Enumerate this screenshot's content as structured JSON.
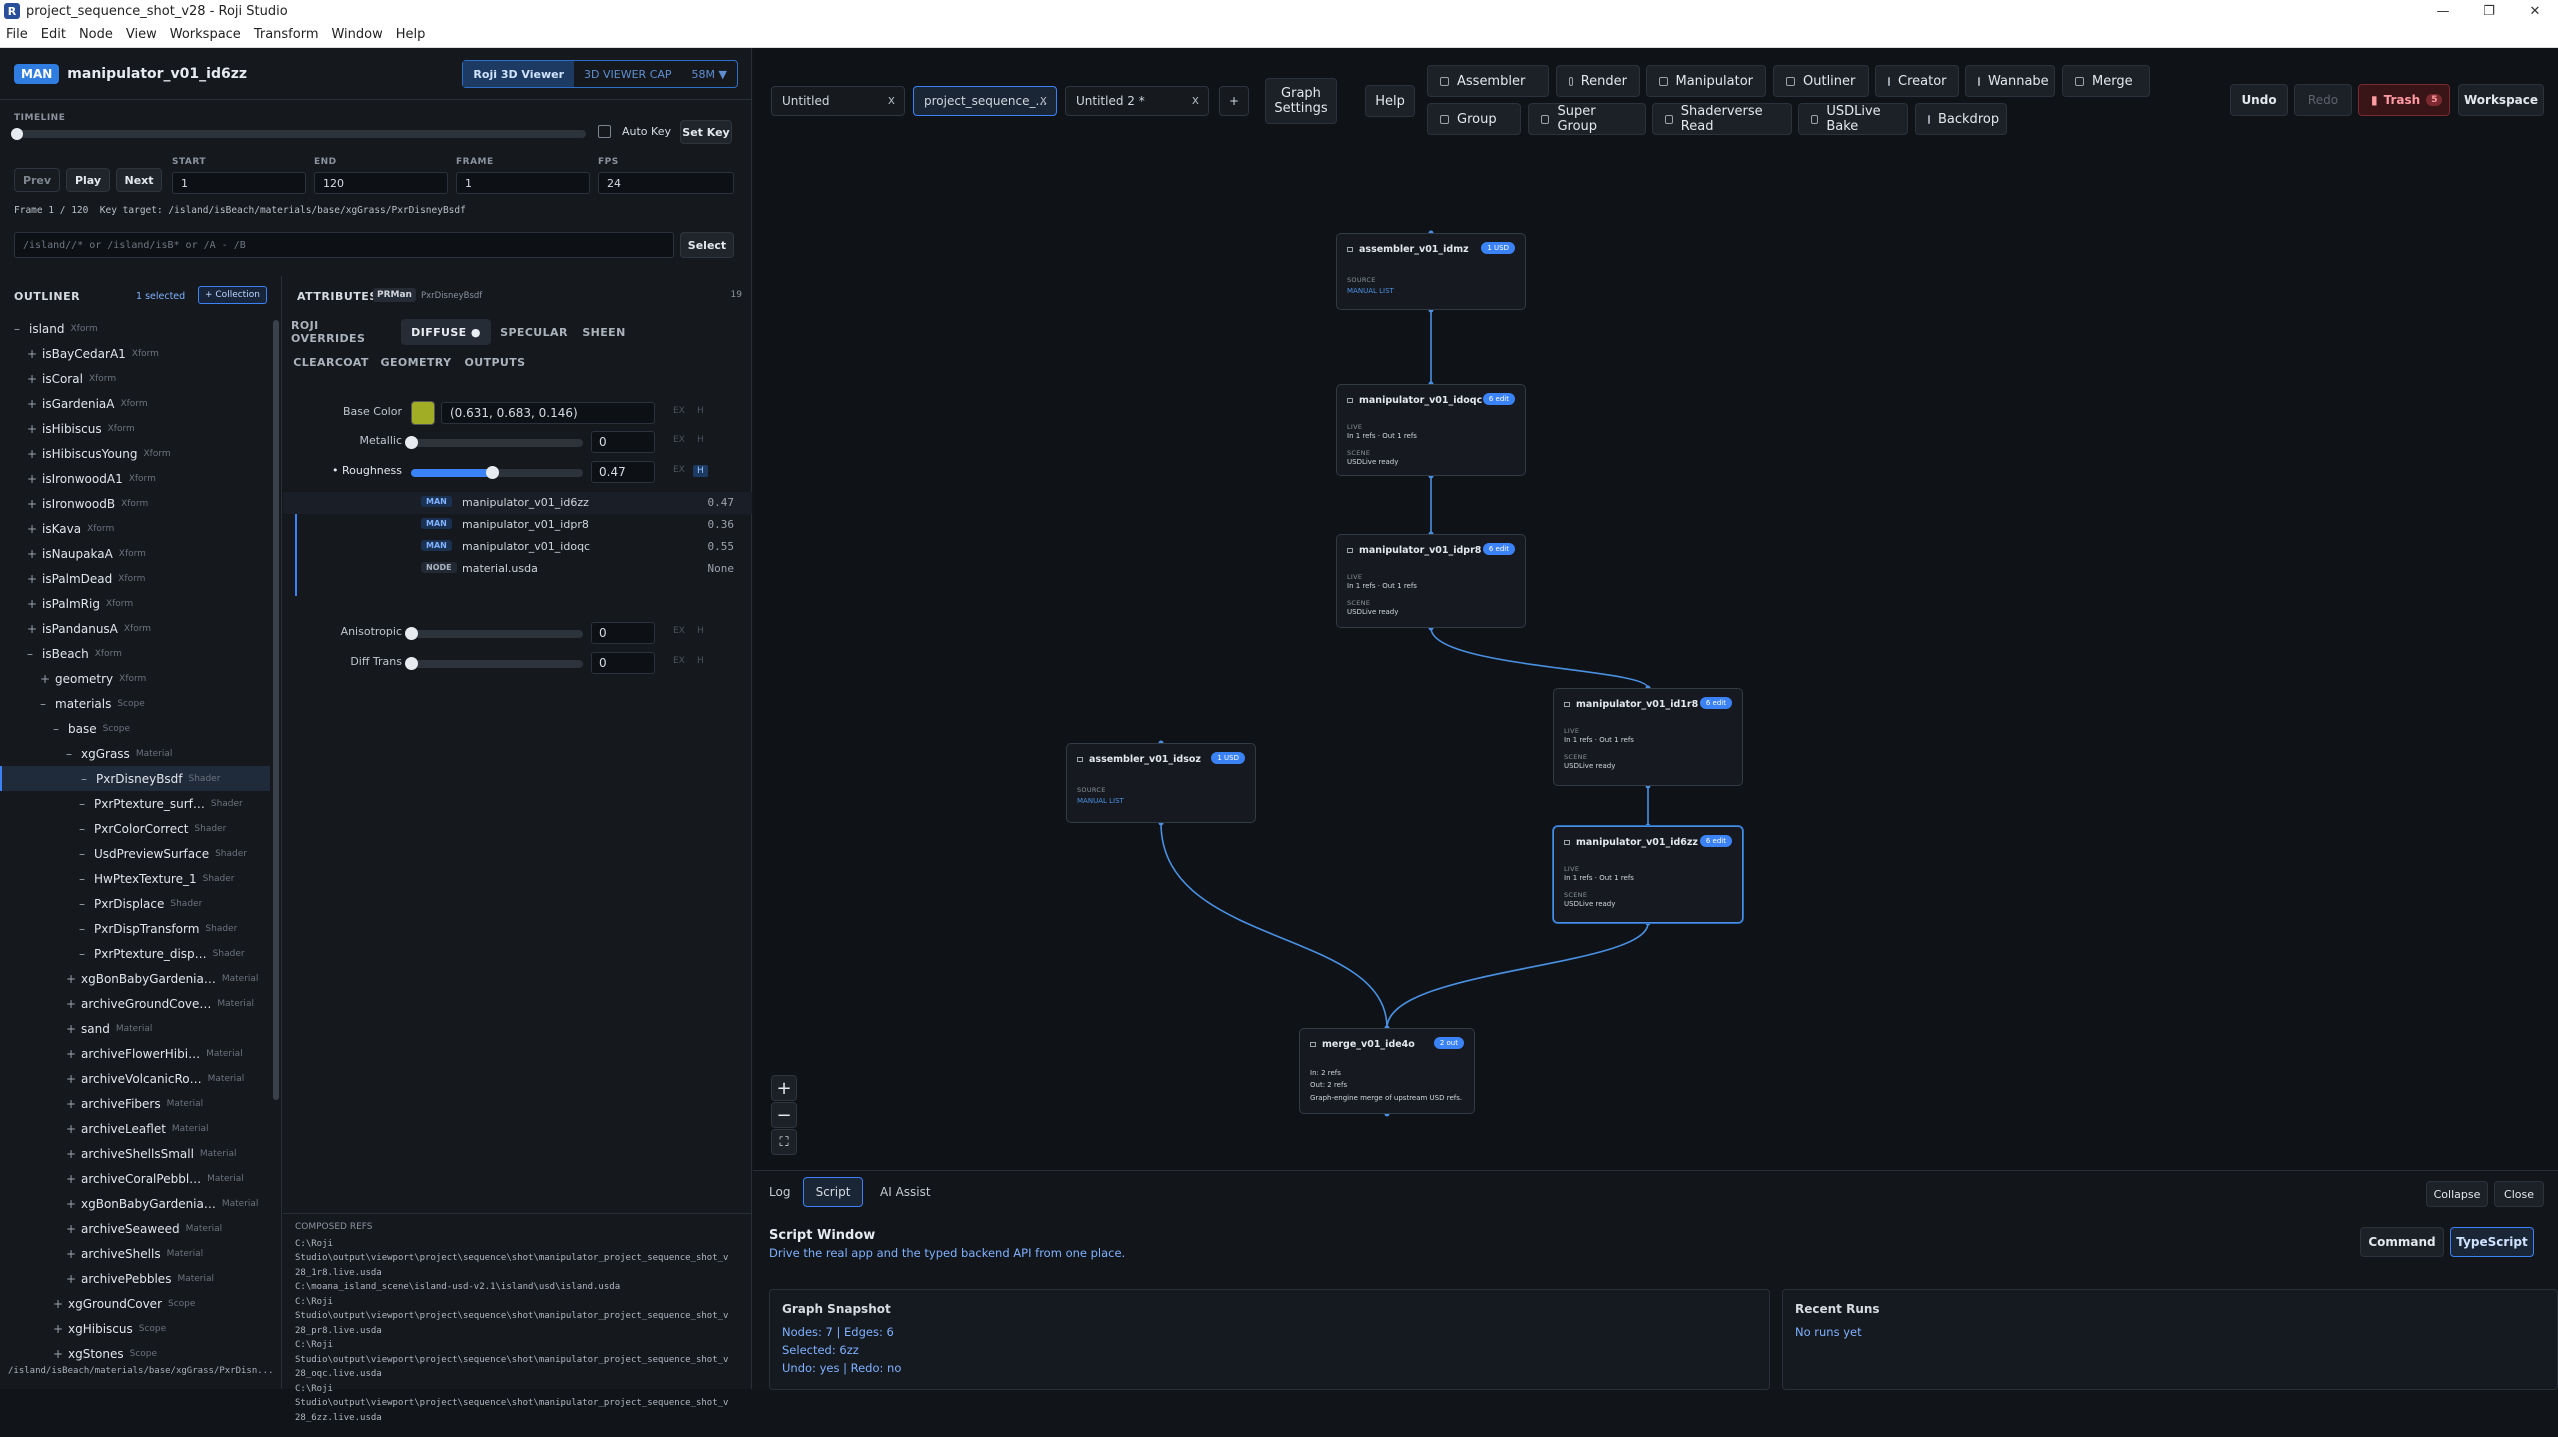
{
  "window": {
    "title": "project_sequence_shot_v28 - Roji Studio",
    "app_letter": "R"
  },
  "menu": [
    "File",
    "Edit",
    "Node",
    "View",
    "Workspace",
    "Transform",
    "Window",
    "Help"
  ],
  "header": {
    "badge": "MAN",
    "node_name": "manipulator_v01_id6zz",
    "viewer_on": "Roji 3D Viewer",
    "viewer_off": "3D VIEWER CAP",
    "viewer_size": "58M ▼"
  },
  "timeline": {
    "label": "TIMELINE",
    "auto_key": "Auto Key",
    "set_key": "Set Key",
    "progress": 0,
    "prev": "Prev",
    "play": "Play",
    "next": "Next",
    "start_label": "START",
    "start": "1",
    "end_label": "END",
    "end": "120",
    "frame_label": "FRAME",
    "frame": "1",
    "fps_label": "FPS",
    "fps": "24",
    "status": "Frame 1 / 120  Key target: /island/isBeach/materials/base/xgGrass/PxrDisneyBsdf",
    "select_placeholder": "/island//*  or  /island/isB*  or  /A - /B",
    "select_btn": "Select"
  },
  "outliner": {
    "title": "OUTLINER",
    "selected": "1 selected",
    "collection_btn": "+ Collection",
    "footer": "/island/isBeach/materials/base/xgGrass/PxrDisn...",
    "rows": [
      {
        "ind": 0,
        "ex": "–",
        "name": "island",
        "tag": "Xform"
      },
      {
        "ind": 1,
        "ex": "+",
        "name": "isBayCedarA1",
        "tag": "Xform"
      },
      {
        "ind": 1,
        "ex": "+",
        "name": "isCoral",
        "tag": "Xform"
      },
      {
        "ind": 1,
        "ex": "+",
        "name": "isGardeniaA",
        "tag": "Xform"
      },
      {
        "ind": 1,
        "ex": "+",
        "name": "isHibiscus",
        "tag": "Xform"
      },
      {
        "ind": 1,
        "ex": "+",
        "name": "isHibiscusYoung",
        "tag": "Xform"
      },
      {
        "ind": 1,
        "ex": "+",
        "name": "isIronwoodA1",
        "tag": "Xform"
      },
      {
        "ind": 1,
        "ex": "+",
        "name": "isIronwoodB",
        "tag": "Xform"
      },
      {
        "ind": 1,
        "ex": "+",
        "name": "isKava",
        "tag": "Xform"
      },
      {
        "ind": 1,
        "ex": "+",
        "name": "isNaupakaA",
        "tag": "Xform"
      },
      {
        "ind": 1,
        "ex": "+",
        "name": "isPalmDead",
        "tag": "Xform"
      },
      {
        "ind": 1,
        "ex": "+",
        "name": "isPalmRig",
        "tag": "Xform"
      },
      {
        "ind": 1,
        "ex": "+",
        "name": "isPandanusA",
        "tag": "Xform"
      },
      {
        "ind": 1,
        "ex": "–",
        "name": "isBeach",
        "tag": "Xform"
      },
      {
        "ind": 2,
        "ex": "+",
        "name": "geometry",
        "tag": "Xform"
      },
      {
        "ind": 2,
        "ex": "–",
        "name": "materials",
        "tag": "Scope"
      },
      {
        "ind": 3,
        "ex": "–",
        "name": "base",
        "tag": "Scope"
      },
      {
        "ind": 4,
        "ex": "–",
        "name": "xgGrass",
        "tag": "Material"
      },
      {
        "ind": 5,
        "ex": "–",
        "name": "PxrDisneyBsdf",
        "tag": "Shader",
        "sel": true
      },
      {
        "ind": 5,
        "ex": "–",
        "name": "PxrPtexture_surf…",
        "tag": "Shader"
      },
      {
        "ind": 5,
        "ex": "–",
        "name": "PxrColorCorrect",
        "tag": "Shader"
      },
      {
        "ind": 5,
        "ex": "–",
        "name": "UsdPreviewSurface",
        "tag": "Shader"
      },
      {
        "ind": 5,
        "ex": "–",
        "name": "HwPtexTexture_1",
        "tag": "Shader"
      },
      {
        "ind": 5,
        "ex": "–",
        "name": "PxrDisplace",
        "tag": "Shader"
      },
      {
        "ind": 5,
        "ex": "–",
        "name": "PxrDispTransform",
        "tag": "Shader"
      },
      {
        "ind": 5,
        "ex": "–",
        "name": "PxrPtexture_disp…",
        "tag": "Shader"
      },
      {
        "ind": 4,
        "ex": "+",
        "name": "xgBonBabyGardenia…",
        "tag": "Material"
      },
      {
        "ind": 4,
        "ex": "+",
        "name": "archiveGroundCove…",
        "tag": "Material"
      },
      {
        "ind": 4,
        "ex": "+",
        "name": "sand",
        "tag": "Material"
      },
      {
        "ind": 4,
        "ex": "+",
        "name": "archiveFlowerHibi…",
        "tag": "Material"
      },
      {
        "ind": 4,
        "ex": "+",
        "name": "archiveVolcanicRo…",
        "tag": "Material"
      },
      {
        "ind": 4,
        "ex": "+",
        "name": "archiveFibers",
        "tag": "Material"
      },
      {
        "ind": 4,
        "ex": "+",
        "name": "archiveLeaflet",
        "tag": "Material"
      },
      {
        "ind": 4,
        "ex": "+",
        "name": "archiveShellsSmall",
        "tag": "Material"
      },
      {
        "ind": 4,
        "ex": "+",
        "name": "archiveCoralPebbl…",
        "tag": "Material"
      },
      {
        "ind": 4,
        "ex": "+",
        "name": "xgBonBabyGardenia…",
        "tag": "Material"
      },
      {
        "ind": 4,
        "ex": "+",
        "name": "archiveSeaweed",
        "tag": "Material"
      },
      {
        "ind": 4,
        "ex": "+",
        "name": "archiveShells",
        "tag": "Material"
      },
      {
        "ind": 4,
        "ex": "+",
        "name": "archivePebbles",
        "tag": "Material"
      },
      {
        "ind": 3,
        "ex": "+",
        "name": "xgGroundCover",
        "tag": "Scope"
      },
      {
        "ind": 3,
        "ex": "+",
        "name": "xgHibiscus",
        "tag": "Scope"
      },
      {
        "ind": 3,
        "ex": "+",
        "name": "xgStones",
        "tag": "Scope"
      }
    ]
  },
  "attributes": {
    "title": "ATTRIBUTES",
    "renderer": "PRMan",
    "shader": "PxrDisneyBsdf",
    "count": "19",
    "tabs": [
      "ROJI OVERRIDES",
      "DIFFUSE ●",
      "SPECULAR",
      "SHEEN",
      "CLEARCOAT",
      "GEOMETRY",
      "OUTPUTS"
    ],
    "base_color_label": "Base Color",
    "base_color_value": "(0.631, 0.683, 0.146)",
    "base_color_hex": "#a1ae25",
    "metallic_label": "Metallic",
    "metallic_value": "0",
    "metallic_level": 0,
    "roughness_label": "• Roughness",
    "roughness_value": "0.47",
    "roughness_level": 0.47,
    "overrides": [
      {
        "type": "MAN",
        "name": "manipulator_v01_id6zz",
        "value": "0.47"
      },
      {
        "type": "MAN",
        "name": "manipulator_v01_idpr8",
        "value": "0.36"
      },
      {
        "type": "MAN",
        "name": "manipulator_v01_idoqc",
        "value": "0.55"
      },
      {
        "type": "NODE",
        "name": "material.usda",
        "value": "None"
      }
    ],
    "anisotropic_label": "Anisotropic",
    "anisotropic_value": "0",
    "anisotropic_level": 0,
    "difftrans_label": "Diff Trans",
    "difftrans_value": "0",
    "difftrans_level": 0,
    "ex": "EX",
    "h": "H"
  },
  "composed": {
    "title": "COMPOSED REFS",
    "lines": [
      "C:\\Roji",
      "Studio\\output\\viewport\\project\\sequence\\shot\\manipulator_project_sequence_shot_v",
      "28_1r8.live.usda",
      "C:\\moana_island_scene\\island-usd-v2.1\\island\\usd\\island.usda",
      "C:\\Roji",
      "Studio\\output\\viewport\\project\\sequence\\shot\\manipulator_project_sequence_shot_v",
      "28_pr8.live.usda",
      "C:\\Roji",
      "Studio\\output\\viewport\\project\\sequence\\shot\\manipulator_project_sequence_shot_v",
      "28_oqc.live.usda",
      "C:\\Roji",
      "Studio\\output\\viewport\\project\\sequence\\shot\\manipulator_project_sequence_shot_v",
      "28_6zz.live.usda"
    ]
  },
  "graph": {
    "tabs": [
      "Untitled",
      "project_sequence_...",
      "Untitled 2 *"
    ],
    "add_tab": "+",
    "graph_settings": "Graph Settings",
    "help": "Help",
    "tools_row1": [
      "Assembler",
      "Render",
      "Manipulator",
      "Outliner",
      "Creator",
      "Wannabe",
      "Merge"
    ],
    "tools_row2": [
      "Group",
      "Super Group",
      "Shaderverse Read",
      "USDLive Bake",
      "Backdrop"
    ],
    "undo": "Undo",
    "redo": "Redo",
    "trash": "Trash",
    "trash_count": "5",
    "workspace": "Workspace",
    "zoom_in": "+",
    "zoom_out": "−",
    "fit": "⛶",
    "nodes": {
      "a1": {
        "name": "assembler_v01_idmz",
        "pill": "1 USD",
        "sec": "SOURCE",
        "line": "MANUAL LIST"
      },
      "m1": {
        "name": "manipulator_v01_idoqc",
        "pill": "6 edit",
        "live": "LIVE",
        "io": "In 1 refs  ·  Out 1 refs",
        "scene": "SCENE",
        "status": "USDLive ready"
      },
      "m2": {
        "name": "manipulator_v01_idpr8",
        "pill": "6 edit",
        "live": "LIVE",
        "io": "In 1 refs  ·  Out 1 refs",
        "scene": "SCENE",
        "status": "USDLive ready"
      },
      "m3": {
        "name": "manipulator_v01_id1r8",
        "pill": "6 edit",
        "live": "LIVE",
        "io": "In 1 refs  ·  Out 1 refs",
        "scene": "SCENE",
        "status": "USDLive ready"
      },
      "m4": {
        "name": "manipulator_v01_id6zz",
        "pill": "6 edit",
        "live": "LIVE",
        "io": "In 1 refs  ·  Out 1 refs",
        "scene": "SCENE",
        "status": "USDLive ready"
      },
      "a2": {
        "name": "assembler_v01_idsoz",
        "pill": "1 USD",
        "sec": "SOURCE",
        "line": "MANUAL LIST"
      },
      "mg": {
        "name": "merge_v01_ide4o",
        "pill": "2 out",
        "in": "In: 2 refs",
        "out": "Out: 2 refs",
        "desc": "Graph-engine merge of upstream USD refs."
      }
    }
  },
  "bottom": {
    "tabs": [
      "Log",
      "Script",
      "AI Assist"
    ],
    "collapse": "Collapse",
    "close": "Close",
    "title": "Script Window",
    "subtitle": "Drive the real app and the typed backend API from one place.",
    "command": "Command",
    "typescript": "TypeScript",
    "snapshot": {
      "title": "Graph Snapshot",
      "nodes_edges": "Nodes: 7 | Edges: 6",
      "selected": "Selected: 6zz",
      "undo": "Undo: yes | Redo: no"
    },
    "runs": {
      "title": "Recent Runs",
      "empty": "No runs yet"
    }
  }
}
